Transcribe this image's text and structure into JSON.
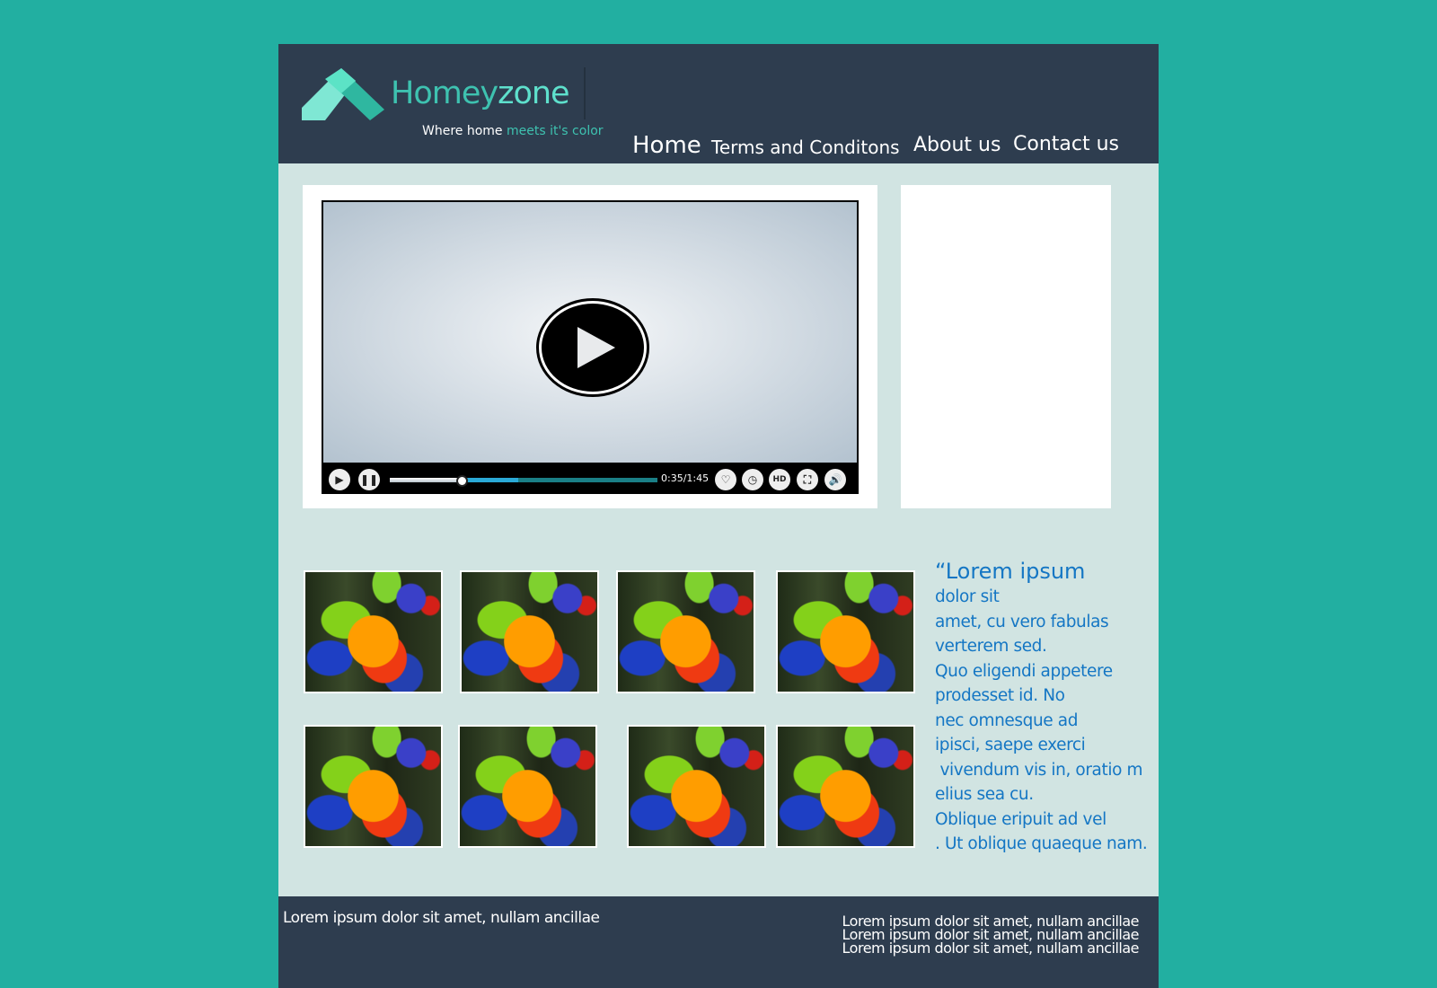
{
  "header": {
    "brand_part1": "Homey",
    "brand_part2": "zone",
    "tagline_part1": "Where home ",
    "tagline_part2": "meets it's color",
    "nav": {
      "home": "Home",
      "terms": "Terms and Conditons",
      "about": "About us",
      "contact": "Contact us"
    }
  },
  "video": {
    "time": "0:35/1:45",
    "played_fraction": 0.27,
    "buffered_fraction": 0.48,
    "controls": [
      "play-icon",
      "pause-icon",
      "heart-icon",
      "clock-icon",
      "hd-icon",
      "fullscreen-icon",
      "volume-icon"
    ],
    "hd_label": "HD"
  },
  "gallery": {
    "image": "rainbow-lorikeet-parrot",
    "count": 8
  },
  "quote": {
    "lines": [
      "“Lorem ipsum",
      "dolor sit",
      "amet, cu vero fabulas",
      "verterem sed.",
      "Quo eligendi appetere",
      "prodesset id. No",
      "nec omnesque ad",
      "ipisci, saepe exerci",
      " vivendum vis in, oratio m",
      "elius sea cu.",
      "Oblique eripuit ad vel",
      ". Ut oblique quaeque nam."
    ]
  },
  "footer": {
    "left": "Lorem ipsum dolor sit amet, nullam ancillae",
    "right": [
      "Lorem ipsum dolor sit amet, nullam ancillae",
      "Lorem ipsum dolor sit amet, nullam ancillae",
      "Lorem ipsum dolor sit amet, nullam ancillae"
    ]
  },
  "colors": {
    "background": "#22afa1",
    "header": "#2e3d4f",
    "content": "#d1e4e2",
    "accent": "#3ec2b0",
    "quote_text": "#1476c4"
  }
}
